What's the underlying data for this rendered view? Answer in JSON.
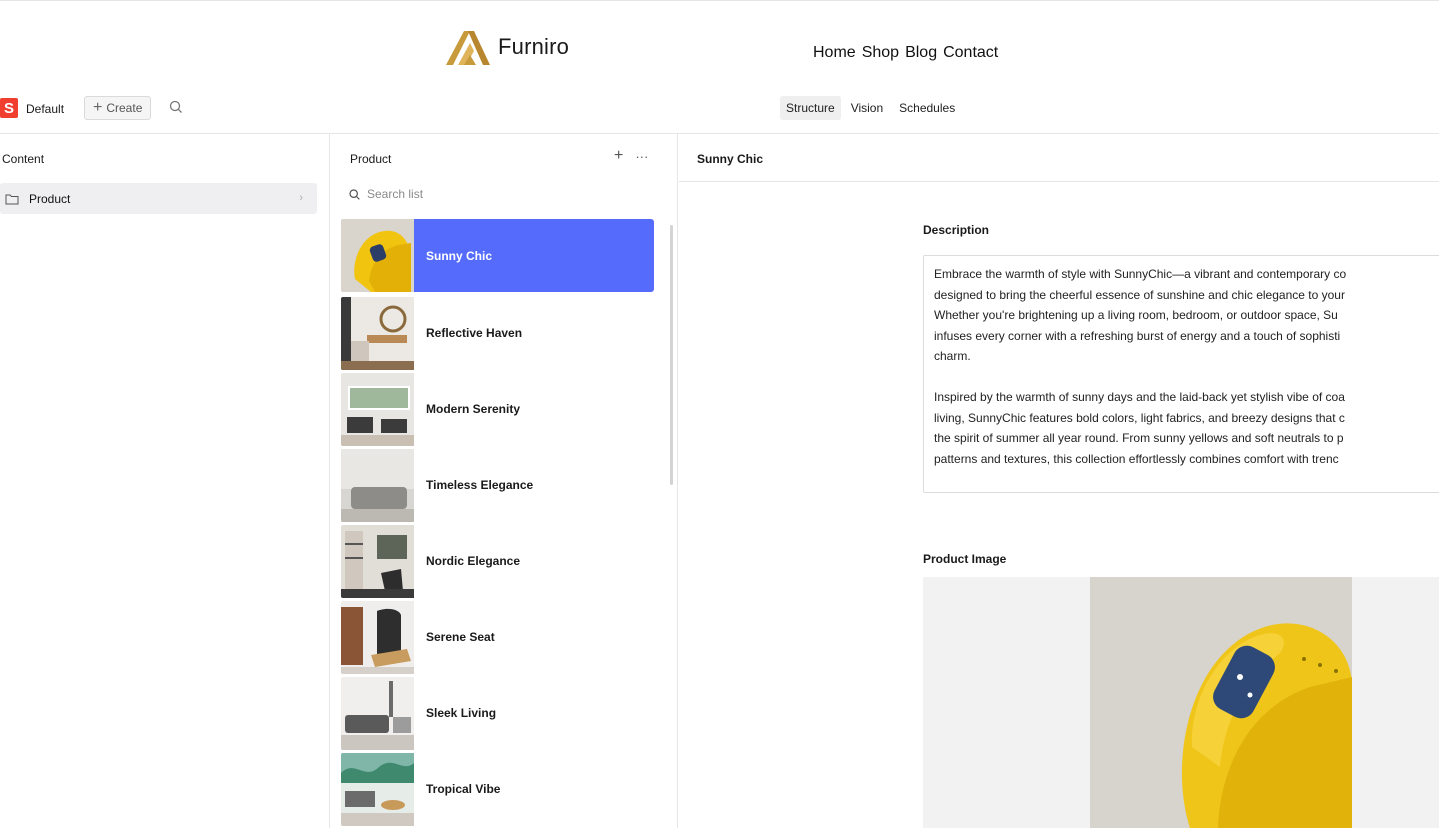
{
  "site": {
    "brand": "Furniro",
    "nav": [
      "Home",
      "Shop",
      "Blog",
      "Contact"
    ]
  },
  "studio": {
    "workspace_badge": "S",
    "workspace_name": "Default",
    "create_label": "Create",
    "tabs": [
      {
        "label": "Structure",
        "active": true
      },
      {
        "label": "Vision",
        "active": false
      },
      {
        "label": "Schedules",
        "active": false
      }
    ]
  },
  "content_pane": {
    "title": "Content",
    "items": [
      {
        "label": "Product"
      }
    ]
  },
  "product_pane": {
    "title": "Product",
    "search_placeholder": "Search list",
    "items": [
      {
        "label": "Sunny Chic",
        "selected": true
      },
      {
        "label": "Reflective Haven",
        "selected": false
      },
      {
        "label": "Modern Serenity",
        "selected": false
      },
      {
        "label": "Timeless Elegance",
        "selected": false
      },
      {
        "label": "Nordic Elegance",
        "selected": false
      },
      {
        "label": "Serene Seat",
        "selected": false
      },
      {
        "label": "Sleek Living",
        "selected": false
      },
      {
        "label": "Tropical Vibe",
        "selected": false
      }
    ]
  },
  "document": {
    "title": "Sunny Chic",
    "description_label": "Description",
    "description_lines": [
      "Embrace the warmth of style with SunnyChic—a vibrant and contemporary co",
      "designed to bring the cheerful essence of sunshine and chic elegance to your",
      "Whether you're brightening up a living room, bedroom, or outdoor space, Su",
      "infuses every corner with a refreshing burst of energy and a touch of sophisti",
      "charm.",
      "",
      "Inspired by the warmth of sunny days and the laid-back yet stylish vibe of coa",
      "living, SunnyChic features bold colors, light fabrics, and breezy designs that c",
      "the spirit of summer all year round. From sunny yellows and soft neutrals to p",
      "patterns and textures, this collection effortlessly combines comfort with trenc"
    ],
    "image_label": "Product Image"
  },
  "colors": {
    "accent": "#556bfc",
    "brand_gold": "#c79a3c",
    "badge_red": "#f03e2f"
  },
  "icons": {
    "logo": "furniro-logo-icon",
    "search": "search-icon",
    "plus": "plus-icon",
    "more": "more-icon",
    "folder": "folder-icon",
    "chevron": "chevron-right-icon"
  }
}
